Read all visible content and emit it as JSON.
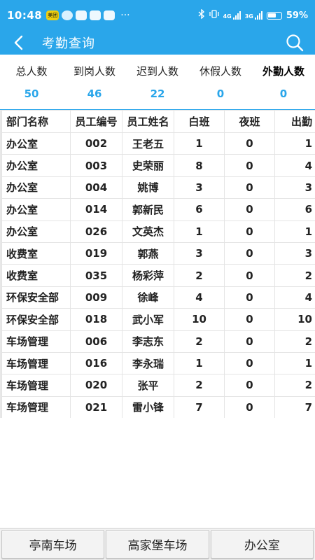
{
  "status_bar": {
    "time": "10:48",
    "app_badge": "美团",
    "more": "···",
    "network_1": "4G",
    "network_2": "3G",
    "battery": "59%"
  },
  "nav": {
    "title": "考勤查询"
  },
  "summary": [
    {
      "label": "总人数",
      "value": "50"
    },
    {
      "label": "到岗人数",
      "value": "46"
    },
    {
      "label": "迟到人数",
      "value": "22"
    },
    {
      "label": "休假人数",
      "value": "0"
    },
    {
      "label": "外勤人数",
      "value": "0"
    }
  ],
  "table": {
    "headers": [
      "部门名称",
      "员工编号",
      "员工姓名",
      "白班",
      "夜班",
      "出勤"
    ],
    "rows": [
      [
        "办公室",
        "002",
        "王老五",
        "1",
        "0",
        "1"
      ],
      [
        "办公室",
        "003",
        "史荣丽",
        "8",
        "0",
        "4"
      ],
      [
        "办公室",
        "004",
        "姚博",
        "3",
        "0",
        "3"
      ],
      [
        "办公室",
        "014",
        "郭新民",
        "6",
        "0",
        "6"
      ],
      [
        "办公室",
        "026",
        "文英杰",
        "1",
        "0",
        "1"
      ],
      [
        "收费室",
        "019",
        "郭燕",
        "3",
        "0",
        "3"
      ],
      [
        "收费室",
        "035",
        "杨彩萍",
        "2",
        "0",
        "2"
      ],
      [
        "环保安全部",
        "009",
        "徐峰",
        "4",
        "0",
        "4"
      ],
      [
        "环保安全部",
        "018",
        "武小军",
        "10",
        "0",
        "10"
      ],
      [
        "车场管理",
        "006",
        "李志东",
        "2",
        "0",
        "2"
      ],
      [
        "车场管理",
        "016",
        "李永瑞",
        "1",
        "0",
        "1"
      ],
      [
        "车场管理",
        "020",
        "张平",
        "2",
        "0",
        "2"
      ],
      [
        "车场管理",
        "021",
        "雷小锋",
        "7",
        "0",
        "7"
      ]
    ]
  },
  "bottom_tabs": [
    "亭南车场",
    "高家堡车场",
    "办公室"
  ],
  "colors": {
    "primary": "#2aa6ea",
    "value_text": "#2aa6ea"
  }
}
